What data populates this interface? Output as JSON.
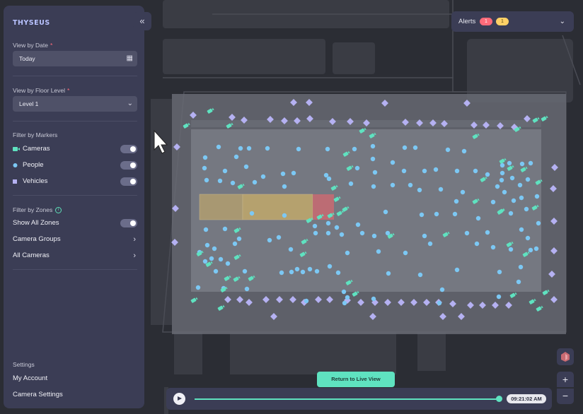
{
  "brand": "THYSEUS",
  "sidebar": {
    "date_label": "View by Date",
    "date_value": "Today",
    "floor_label": "View by Floor Level",
    "floor_value": "Level 1",
    "markers_label": "Filter by Markers",
    "markers": [
      {
        "label": "Cameras",
        "icon": "camera-icon",
        "color": "#5fe2c0",
        "enabled": true
      },
      {
        "label": "People",
        "icon": "person-dot-icon",
        "color": "#7cc8f4",
        "enabled": true
      },
      {
        "label": "Vehicles",
        "icon": "vehicle-square-icon",
        "color": "#b5b1f2",
        "enabled": true
      }
    ],
    "zones_label": "Filter by Zones",
    "show_all_zones": "Show All Zones",
    "camera_groups": "Camera Groups",
    "all_cameras": "All Cameras",
    "settings_label": "Settings",
    "my_account": "My Account",
    "camera_settings": "Camera Settings"
  },
  "alerts": {
    "label": "Alerts",
    "red_count": "1",
    "yellow_count": "1",
    "red_color": "#ff6b7a",
    "yellow_color": "#ffd166"
  },
  "return_live": "Return to Live View",
  "timeline": {
    "time": "09:21:02 AM"
  },
  "zoom": {
    "plus": "+",
    "minus": "−"
  },
  "colors": {
    "accent": "#5fe2c0",
    "person": "#7cc8f4",
    "vehicle": "#b5b1f2",
    "zone_yellow": "#b5a16e",
    "zone_red": "#c96a72"
  }
}
